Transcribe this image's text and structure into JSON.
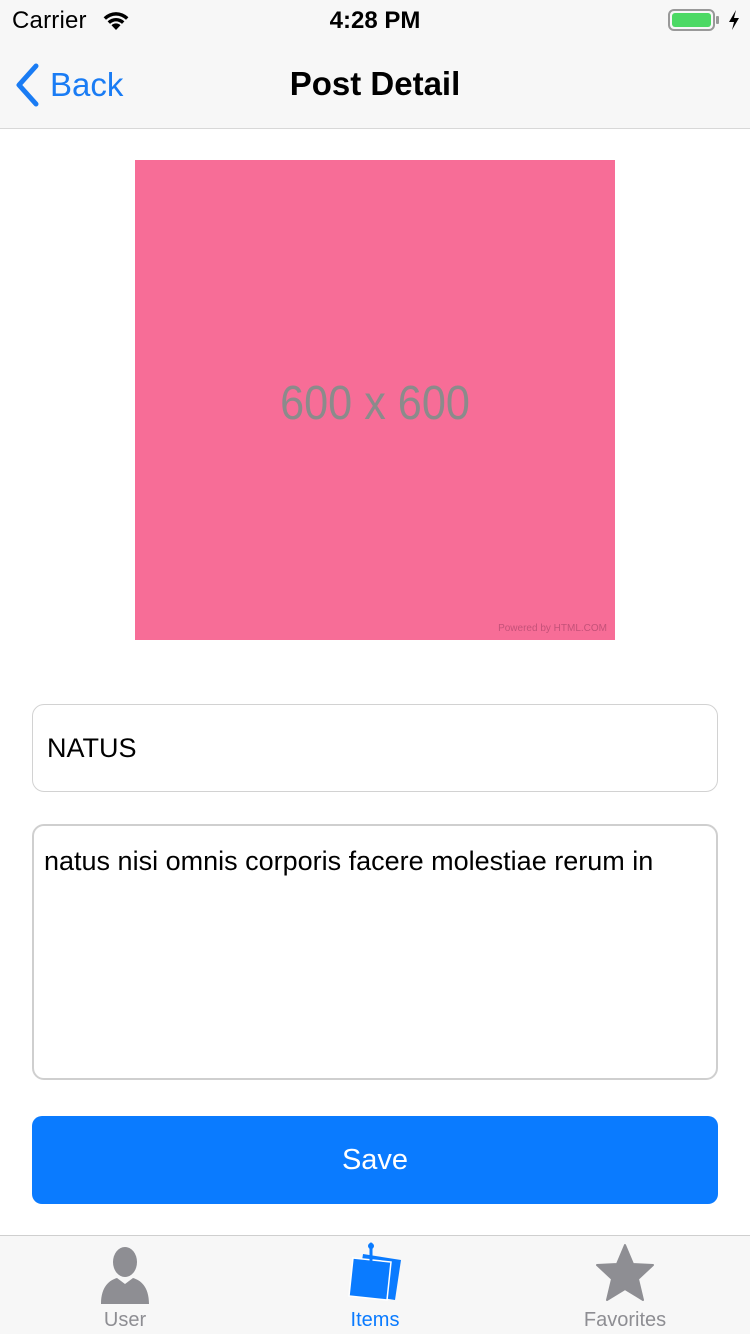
{
  "status_bar": {
    "carrier": "Carrier",
    "time": "4:28 PM",
    "battery_color": "#4cd964"
  },
  "nav": {
    "back_label": "Back",
    "title": "Post Detail"
  },
  "image": {
    "placeholder_text": "600 x 600",
    "credit": "Powered by HTML.COM",
    "color": "#f76d97"
  },
  "form": {
    "title_value": "NATUS",
    "body_value": "natus nisi omnis corporis facere molestiae rerum in",
    "save_label": "Save"
  },
  "tabs": [
    {
      "label": "User",
      "icon": "user-icon",
      "active": false
    },
    {
      "label": "Items",
      "icon": "note-icon",
      "active": true
    },
    {
      "label": "Favorites",
      "icon": "star-icon",
      "active": false
    }
  ],
  "colors": {
    "accent": "#0a7bff",
    "inactive": "#8e8e93"
  }
}
